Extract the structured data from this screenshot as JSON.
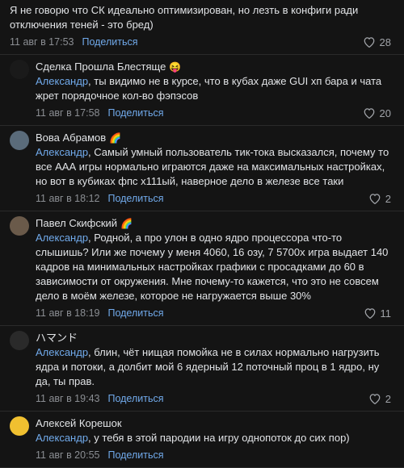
{
  "top_comment": {
    "text": "Я не говорю что СК идеально оптимизирован, но лезть в конфиги ради отключения теней - это бред)",
    "date": "11 авг в 17:53",
    "share": "Поделиться",
    "likes": "28"
  },
  "comments": [
    {
      "name": "Сделка Прошла Блестяще",
      "emoji": "😝",
      "reply_to": "Александр",
      "text": ", ты видимо не в курсе, что в кубах даже GUI хп бара и чата жрет порядочное кол-во фэпэсов",
      "date": "11 авг в 17:58",
      "share": "Поделиться",
      "likes": "20",
      "avatar_color": "#1a1a1a"
    },
    {
      "name": "Вова Абрамов",
      "emoji": "🌈",
      "reply_to": "Александр",
      "text": ", Самый умный пользователь тик-тока высказался, почему то все ААА игры нормально играются даже на максимальных настройках, но вот в кубиках фпс х111ый, наверное дело в железе все таки",
      "date": "11 авг в 18:12",
      "share": "Поделиться",
      "likes": "2",
      "avatar_color": "#5a6b7a"
    },
    {
      "name": "Павел Скифский",
      "emoji": "🌈",
      "reply_to": "Александр",
      "text": ", Родной, а про улон в одно ядро процессора что-то слышишь? Или же почему у меня 4060, 16 озу, 7 5700х игра выдает 140 кадров на минимальных настройках графики с просадками до 60 в зависимости от окружения. Мне почему-то кажется, что это не совсем дело в моём железе, которое не нагружается выше 30%",
      "date": "11 авг в 18:19",
      "share": "Поделиться",
      "likes": "11",
      "avatar_color": "#6a5a4a"
    },
    {
      "name": "ハマンド",
      "emoji": "",
      "reply_to": "Александр",
      "text": ", блин, чёт нищая помойка не в силах нормально нагрузить ядра и потоки, а долбит мой 6 ядерный 12 поточный проц в 1 ядро, ну да, ты прав.",
      "date": "11 авг в 19:43",
      "share": "Поделиться",
      "likes": "2",
      "avatar_color": "#2a2a2a"
    },
    {
      "name": "Алексей Корешок",
      "emoji": "",
      "reply_to": "Александр",
      "text": ", у тебя в этой пародии на игру однопоток до сих пор)",
      "date": "11 авг в 20:55",
      "share": "Поделиться",
      "likes": "",
      "avatar_color": "#f0c030"
    }
  ]
}
